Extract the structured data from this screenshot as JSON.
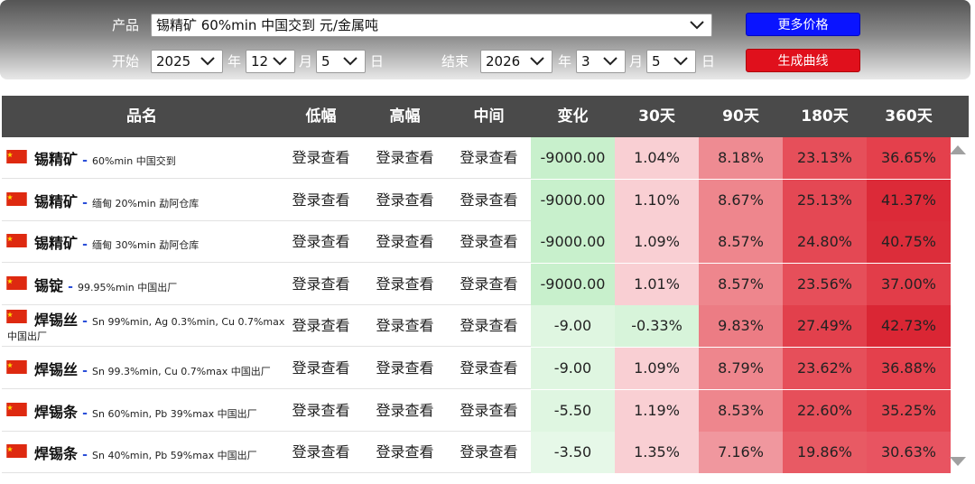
{
  "controls": {
    "product_label": "产品",
    "product_value": "锡精矿 60%min 中国交到 元/金属吨",
    "start_label": "开始",
    "end_label": "结束",
    "start": {
      "year": "2025",
      "month": "12",
      "day": "5"
    },
    "end": {
      "year": "2026",
      "month": "3",
      "day": "5"
    },
    "year_unit": "年",
    "month_unit": "月",
    "day_unit": "日",
    "more_prices_button": "更多价格",
    "generate_curve_button": "生成曲线"
  },
  "table": {
    "headers": [
      "品名",
      "低幅",
      "高幅",
      "中间",
      "变化",
      "30天",
      "90天",
      "180天",
      "360天"
    ],
    "rows": [
      {
        "name": "锡精矿",
        "spec": "60%min 中国交到",
        "spec2": "",
        "low": "登录查看",
        "high": "登录查看",
        "mid": "登录查看",
        "change": "-9000.00",
        "d30": "1.04%",
        "d90": "8.18%",
        "d180": "23.13%",
        "d360": "36.65%"
      },
      {
        "name": "锡精矿",
        "spec": "缅甸 20%min 勐阿仓库",
        "spec2": "",
        "low": "登录查看",
        "high": "登录查看",
        "mid": "登录查看",
        "change": "-9000.00",
        "d30": "1.10%",
        "d90": "8.67%",
        "d180": "25.13%",
        "d360": "41.37%"
      },
      {
        "name": "锡精矿",
        "spec": "缅甸 30%min 勐阿仓库",
        "spec2": "",
        "low": "登录查看",
        "high": "登录查看",
        "mid": "登录查看",
        "change": "-9000.00",
        "d30": "1.09%",
        "d90": "8.57%",
        "d180": "24.80%",
        "d360": "40.75%"
      },
      {
        "name": "锡锭",
        "spec": "99.95%min 中国出厂",
        "spec2": "",
        "low": "登录查看",
        "high": "登录查看",
        "mid": "登录查看",
        "change": "-9000.00",
        "d30": "1.01%",
        "d90": "8.57%",
        "d180": "23.56%",
        "d360": "37.00%"
      },
      {
        "name": "焊锡丝",
        "spec": "Sn 99%min, Ag 0.3%min, Cu 0.7%max",
        "spec2": "中国出厂",
        "low": "登录查看",
        "high": "登录查看",
        "mid": "登录查看",
        "change": "-9.00",
        "d30": "-0.33%",
        "d90": "9.83%",
        "d180": "27.49%",
        "d360": "42.73%"
      },
      {
        "name": "焊锡丝",
        "spec": "Sn 99.3%min, Cu 0.7%max 中国出厂",
        "spec2": "",
        "low": "登录查看",
        "high": "登录查看",
        "mid": "登录查看",
        "change": "-9.00",
        "d30": "1.09%",
        "d90": "8.79%",
        "d180": "23.62%",
        "d360": "36.88%"
      },
      {
        "name": "焊锡条",
        "spec": "Sn 60%min, Pb 39%max 中国出厂",
        "spec2": "",
        "low": "登录查看",
        "high": "登录查看",
        "mid": "登录查看",
        "change": "-5.50",
        "d30": "1.19%",
        "d90": "8.53%",
        "d180": "22.60%",
        "d360": "35.25%"
      },
      {
        "name": "焊锡条",
        "spec": "Sn 40%min, Pb 59%max 中国出厂",
        "spec2": "",
        "low": "登录查看",
        "high": "登录查看",
        "mid": "登录查看",
        "change": "-3.50",
        "d30": "1.35%",
        "d90": "7.16%",
        "d180": "19.86%",
        "d360": "30.63%"
      }
    ],
    "cell_colors": {
      "change": [
        "#c8f0cc",
        "#c8f0cc",
        "#c8f0cc",
        "#c8f0cc",
        "#dff6e1",
        "#dff6e1",
        "#dff6e1",
        "#e6f8e8"
      ],
      "d30": [
        "#f9cfd3",
        "#f9cfd3",
        "#f9cfd3",
        "#f9cfd3",
        "#d7f4da",
        "#f9cfd3",
        "#f9cfd3",
        "#f9cfd3"
      ],
      "d90": [
        "#ee8b92",
        "#ee868d",
        "#ee868d",
        "#ee868d",
        "#ec7c84",
        "#ee868d",
        "#ee868d",
        "#f0979e"
      ],
      "d180": [
        "#e64f5a",
        "#e44854",
        "#e44854",
        "#e64f5a",
        "#e2404c",
        "#e64f5a",
        "#e64f5a",
        "#e85a64"
      ],
      "d360": [
        "#e4404c",
        "#dc2a38",
        "#dc2d3a",
        "#e23d49",
        "#da2634",
        "#e4404c",
        "#e54550",
        "#e85461"
      ]
    }
  },
  "flag_colors": {
    "red": "#de2910",
    "star": "#ffde00"
  }
}
